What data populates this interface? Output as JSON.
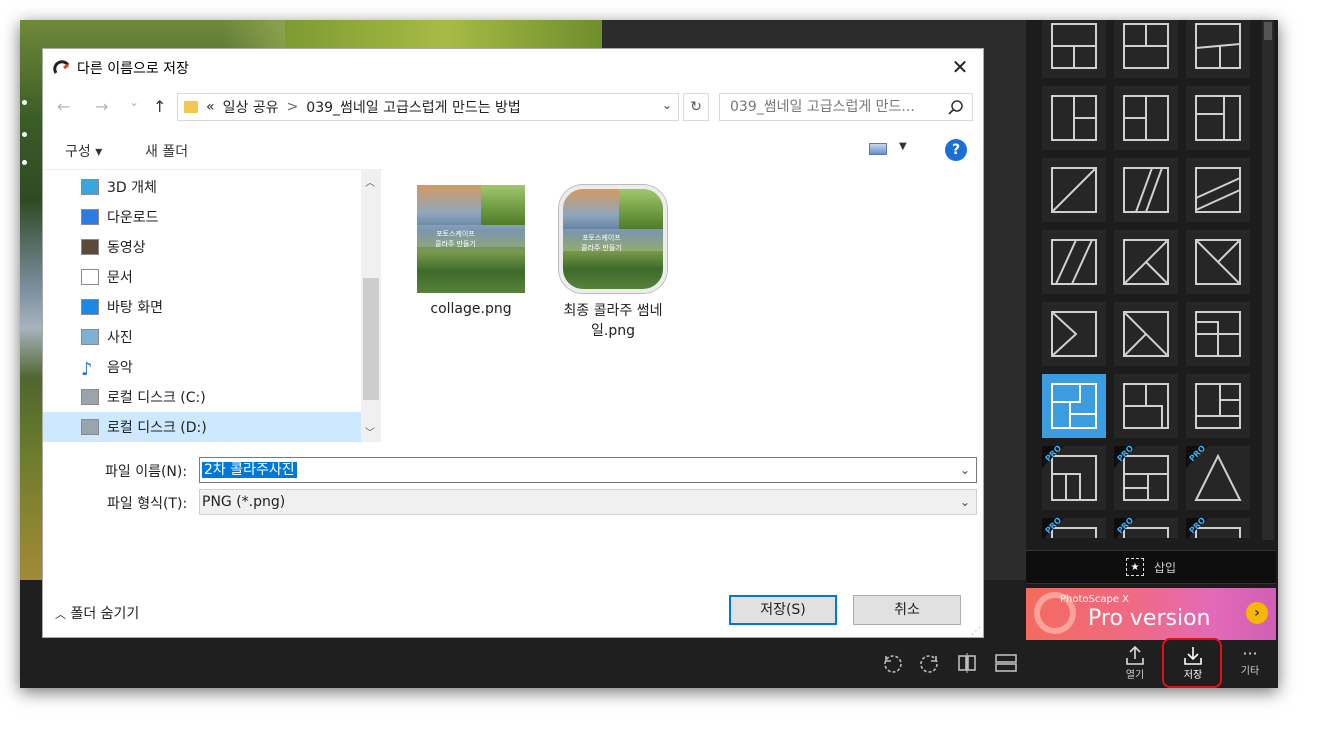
{
  "dialog": {
    "title": "다른 이름으로 저장",
    "close_glyph": "✕",
    "nav": {
      "back": "←",
      "forward": "→",
      "recent": "⌄",
      "up": "↑"
    },
    "address": {
      "prefix": "«",
      "path": [
        "일상 공유",
        "039_썸네일 고급스럽게 만드는 방법"
      ],
      "separator": ">"
    },
    "refresh_glyph": "↻",
    "search_placeholder": "039_썸네일 고급스럽게 만드...",
    "commands": {
      "organize": "구성 ▾",
      "new_folder": "새 폴더",
      "help": "?"
    },
    "nav_items": [
      {
        "label": "3D 개체",
        "icon": "cube-icon"
      },
      {
        "label": "다운로드",
        "icon": "download-icon"
      },
      {
        "label": "동영상",
        "icon": "video-icon"
      },
      {
        "label": "문서",
        "icon": "document-icon"
      },
      {
        "label": "바탕 화면",
        "icon": "desktop-icon"
      },
      {
        "label": "사진",
        "icon": "pictures-icon"
      },
      {
        "label": "음악",
        "icon": "music-icon"
      },
      {
        "label": "로컬 디스크 (C:)",
        "icon": "drive-c-icon"
      },
      {
        "label": "로컬 디스크 (D:)",
        "icon": "drive-d-icon",
        "active": true
      }
    ],
    "files": [
      {
        "name": "collage.png",
        "thumb_text": "포토스케이프\n콜라주 만들기"
      },
      {
        "name": "최종 콜라주 썸네\n일.png",
        "thumb_text": "포토스케이프\n콜라주 만들기"
      }
    ],
    "filename_label": "파일 이름(N):",
    "filename_value": "2차 콜라주사진",
    "filetype_label": "파일 형식(T):",
    "filetype_value": "PNG (*.png)",
    "hide_folders": "폴더 숨기기",
    "save_button": "저장(S)",
    "cancel_button": "취소"
  },
  "panel": {
    "insert_label": "삽입",
    "promo": {
      "small": "PhotoScape X",
      "big": "Pro version"
    },
    "pro_badge": "PRO"
  },
  "toolbar": {
    "open_label": "열기",
    "save_label": "저장",
    "more_label": "기타"
  },
  "colors": {
    "accent": "#3b9de0",
    "highlight": "#e0101a",
    "dialog_primary": "#0078d7"
  }
}
